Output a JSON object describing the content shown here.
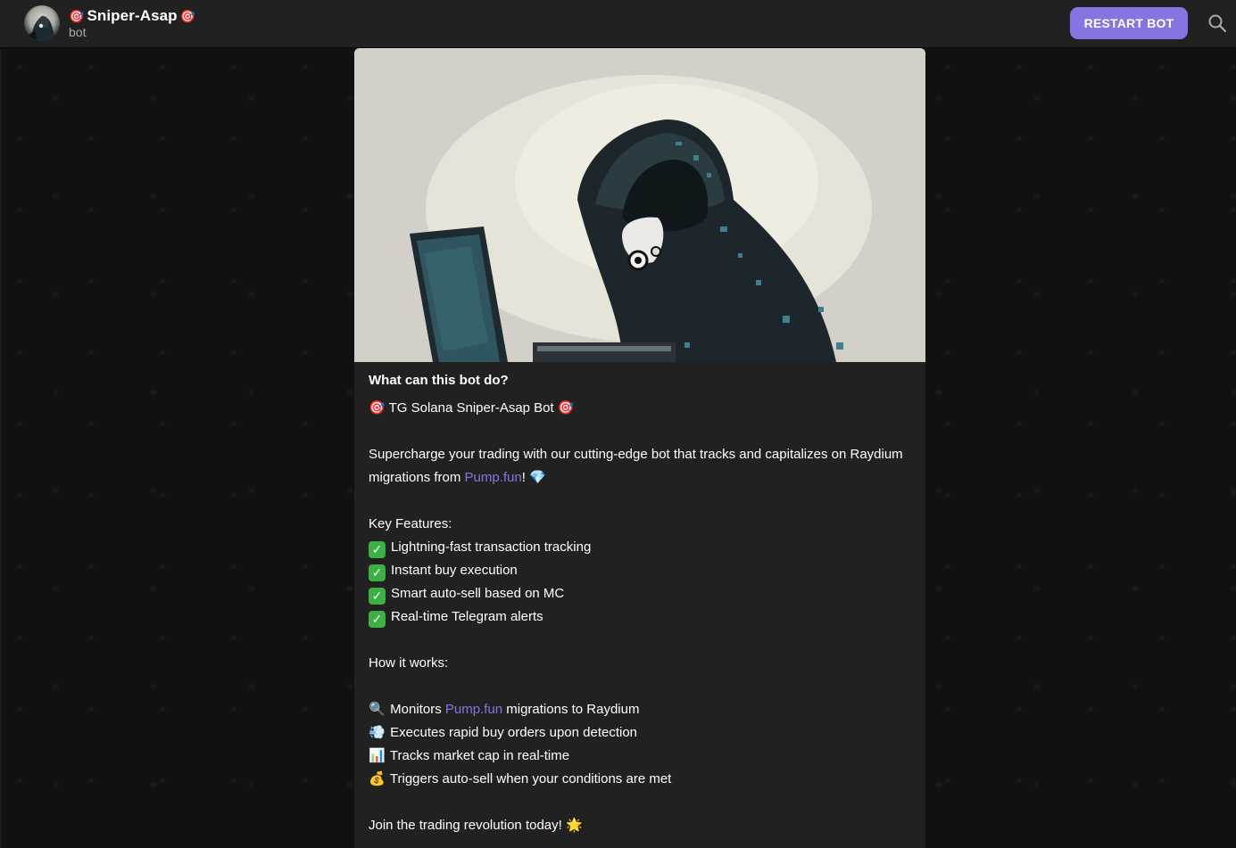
{
  "header": {
    "title_prefix_emoji": "🎯",
    "title": "Sniper-Asap",
    "title_suffix_emoji": "🎯",
    "subtitle": "bot",
    "restart_label": "RESTART BOT",
    "search_icon": "search-icon",
    "avatar_icon": "hooded-hacker-avatar"
  },
  "colors": {
    "accent": "#8774e1",
    "header_bg": "#212121",
    "card_bg": "#212121",
    "chat_bg": "#111111",
    "link": "#8774e1",
    "check": "#3cb043"
  },
  "card": {
    "image_icon": "hooded-hacker-illustration",
    "heading": "What can this bot do?",
    "bot_title_emoji_left": "🎯",
    "bot_title": "TG Solana Sniper-Asap Bot",
    "bot_title_emoji_right": "🎯",
    "intro_line1": "Supercharge your trading with our cutting-edge bot that tracks and capitalizes on Raydium",
    "intro_line2_prefix": "migrations from ",
    "intro_link": "Pump.fun",
    "intro_line2_suffix": "!",
    "intro_emoji": "💎",
    "features_heading": "Key Features:",
    "features": [
      {
        "icon": "✓",
        "label": "Lightning-fast transaction tracking"
      },
      {
        "icon": "✓",
        "label": "Instant buy execution"
      },
      {
        "icon": "✓",
        "label": "Smart auto-sell based on MC"
      },
      {
        "icon": "✓",
        "label": "Real-time Telegram alerts"
      }
    ],
    "how_heading": "How it works:",
    "how_1_emoji": "🔍",
    "how_1_prefix": "Monitors ",
    "how_1_link": "Pump.fun",
    "how_1_suffix": " migrations to Raydium",
    "how_2_emoji": "💨",
    "how_2": "Executes rapid buy orders upon detection",
    "how_3_emoji": "📊",
    "how_3": "Tracks market cap in real-time",
    "how_4_emoji": "💰",
    "how_4": "Triggers auto-sell when your conditions are met",
    "closing": "Join the trading revolution today!",
    "closing_emoji": "🌟"
  }
}
